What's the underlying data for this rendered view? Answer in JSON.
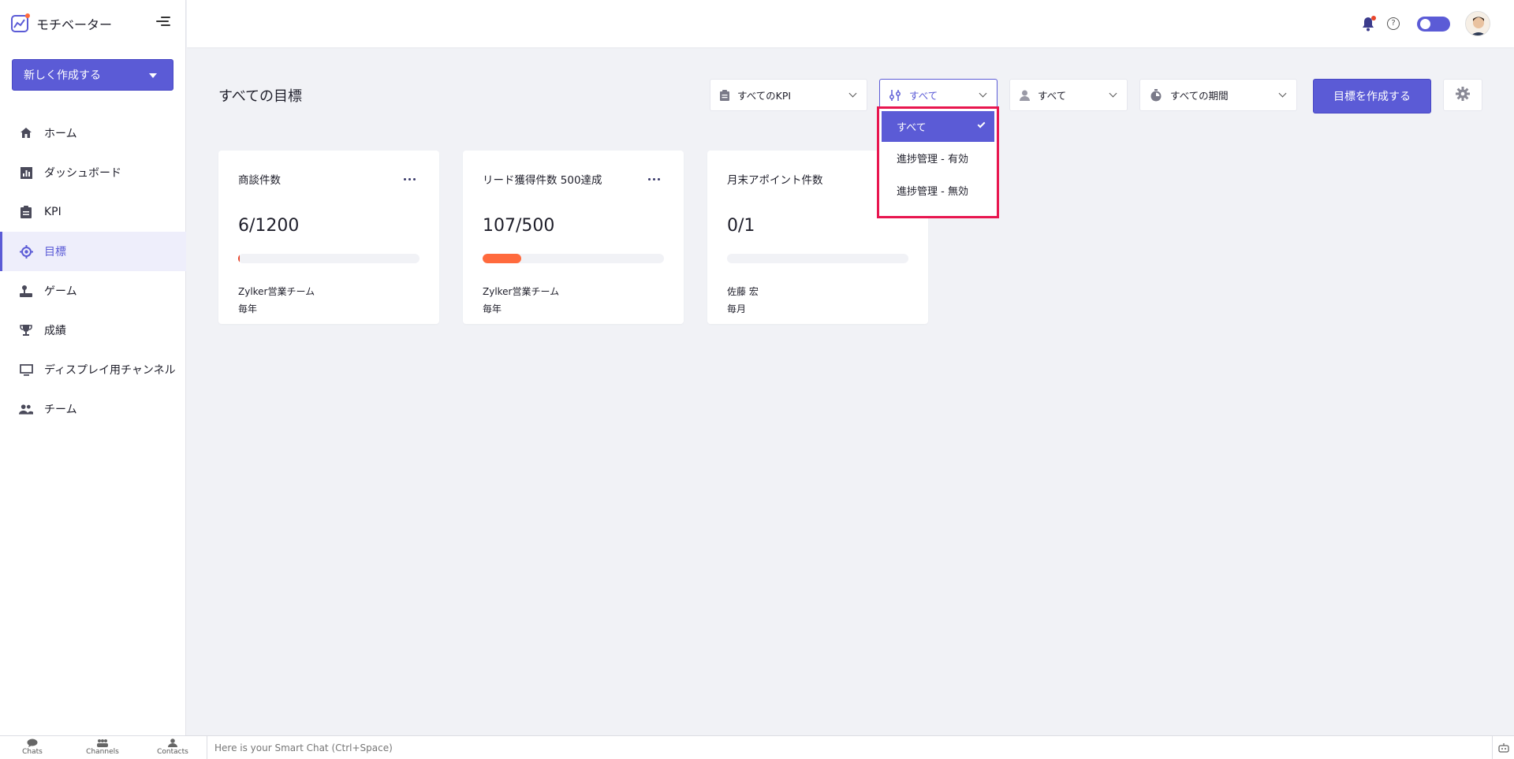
{
  "app": {
    "name": "モチベーター"
  },
  "sidebar": {
    "create_label": "新しく作成する",
    "items": [
      {
        "label": "ホーム",
        "icon": "home-icon"
      },
      {
        "label": "ダッシュボード",
        "icon": "dashboard-icon"
      },
      {
        "label": "KPI",
        "icon": "clipboard-icon"
      },
      {
        "label": "目標",
        "icon": "target-icon",
        "active": true
      },
      {
        "label": "ゲーム",
        "icon": "joystick-icon"
      },
      {
        "label": "成績",
        "icon": "trophy-icon"
      },
      {
        "label": "ディスプレイ用チャンネル",
        "icon": "monitor-icon"
      },
      {
        "label": "チーム",
        "icon": "team-icon"
      }
    ]
  },
  "main": {
    "title": "すべての目標",
    "filters": {
      "kpi": "すべてのKPI",
      "progress": "すべて",
      "user": "すべて",
      "period": "すべての期間"
    },
    "create_goal_label": "目標を作成する"
  },
  "dropdown": {
    "options": [
      {
        "label": "すべて",
        "selected": true
      },
      {
        "label": "進捗管理 - 有効"
      },
      {
        "label": "進捗管理 - 無効"
      }
    ]
  },
  "goals": [
    {
      "title": "商談件数",
      "value": "6/1200",
      "progress": 0.005,
      "team": "Zylker営業チーム",
      "period": "毎年"
    },
    {
      "title": "リード獲得件数 500達成",
      "value": "107/500",
      "progress": 0.214,
      "team": "Zylker営業チーム",
      "period": "毎年"
    },
    {
      "title": "月末アポイント件数",
      "value": "0/1",
      "progress": 0,
      "team": "佐藤 宏",
      "period": "毎月"
    }
  ],
  "bottombar": {
    "chats": "Chats",
    "channels": "Channels",
    "contacts": "Contacts",
    "chat_placeholder": "Here is your Smart Chat (Ctrl+Space)"
  },
  "colors": {
    "accent": "#5b5bd6",
    "progress": "#ff6a3d",
    "highlight": "#e8164f"
  }
}
